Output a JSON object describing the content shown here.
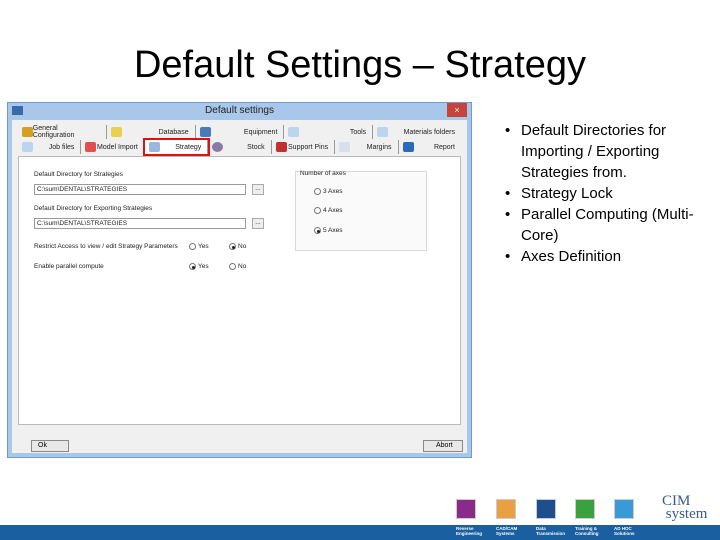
{
  "slide": {
    "title": "Default Settings – Strategy",
    "bullets": [
      "Default Directories for Importing / Exporting Strategies from.",
      "Strategy Lock",
      "Parallel Computing (Multi-Core)",
      "Axes Definition"
    ]
  },
  "dialog": {
    "title": "Default settings",
    "close": "×",
    "tabs_row1": [
      "General Configuration",
      "Database",
      "Equipment",
      "Tools",
      "Materials folders"
    ],
    "tabs_row2": [
      "Job files",
      "Model Import",
      "Strategy",
      "Stock",
      "Support Pins",
      "Margins",
      "Report"
    ],
    "selected_tab": "Strategy",
    "strategies_label": "Default Directory for Strategies",
    "strategies_value": "C:\\sum\\DENTAL\\STRATEGIES",
    "export_label": "Default Directory for Exporting Strategies",
    "export_value": "C:\\sum\\DENTAL\\STRATEGIES",
    "browse": "...",
    "restrict_label": "Restrict Access to view / edit Strategy Parameters",
    "restrict_value": "No",
    "parallel_label": "Enable parallel compute",
    "parallel_value": "Yes",
    "yes": "Yes",
    "no": "No",
    "axes_label": "Number of axes",
    "axes_options": [
      "3 Axes",
      "4 Axes",
      "5 Axes"
    ],
    "axes_value": "5 Axes",
    "ok": "Ok",
    "abort": "Abort"
  },
  "footer": {
    "items": [
      {
        "label": "Reverse Engineering",
        "color": "#8a2b8a"
      },
      {
        "label": "CAD/CAM Systems",
        "color": "#e8a040"
      },
      {
        "label": "Data Transmission",
        "color": "#1d4f8f"
      },
      {
        "label": "Training & Consulting",
        "color": "#3aa040"
      },
      {
        "label": "AD HOC Solutions",
        "color": "#3a9ad8"
      }
    ],
    "logo": "CIM system"
  }
}
